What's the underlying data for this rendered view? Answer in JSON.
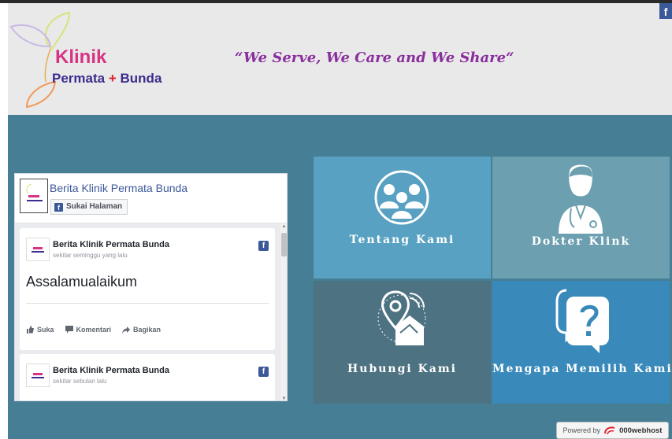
{
  "header": {
    "logo_title": "Klinik",
    "logo_sub_1": "Permata",
    "logo_sub_plus": "+",
    "logo_sub_2": "Bunda",
    "slogan": "“We Serve, We Care and We Share“",
    "fb_corner": "f"
  },
  "widget": {
    "page_title": "Berita Klinik Permata Bunda",
    "like_page": "Sukai Halaman",
    "posts": [
      {
        "author": "Berita Klinik Permata Bunda",
        "time": "sekitar seminggu yang lalu",
        "text": "Assalamualaikum"
      },
      {
        "author": "Berita Klinik Permata Bunda",
        "time": "sekitar sebulan lalu"
      }
    ],
    "actions": {
      "like": "Suka",
      "comment": "Komentari",
      "share": "Bagikan"
    }
  },
  "tiles": [
    {
      "label": "Tentang Kami",
      "icon": "group-icon"
    },
    {
      "label": "Dokter Klink",
      "icon": "doctor-icon"
    },
    {
      "label": "Hubungi Kami",
      "icon": "map-pin-phone-icon"
    },
    {
      "label": "Mengapa Memilih Kami",
      "icon": "question-bubble-icon"
    }
  ],
  "footer": {
    "powered_by": "Powered by",
    "brand": "000webhost"
  },
  "colors": {
    "header_bg": "#e9e9e9",
    "main_bg": "#457e95",
    "tile1": "#58a1c2",
    "tile2": "#6c9fb0",
    "tile3": "#4d7281",
    "tile4": "#398aba",
    "logo_pink": "#d63384",
    "slogan_purple": "#8a2f9e"
  }
}
